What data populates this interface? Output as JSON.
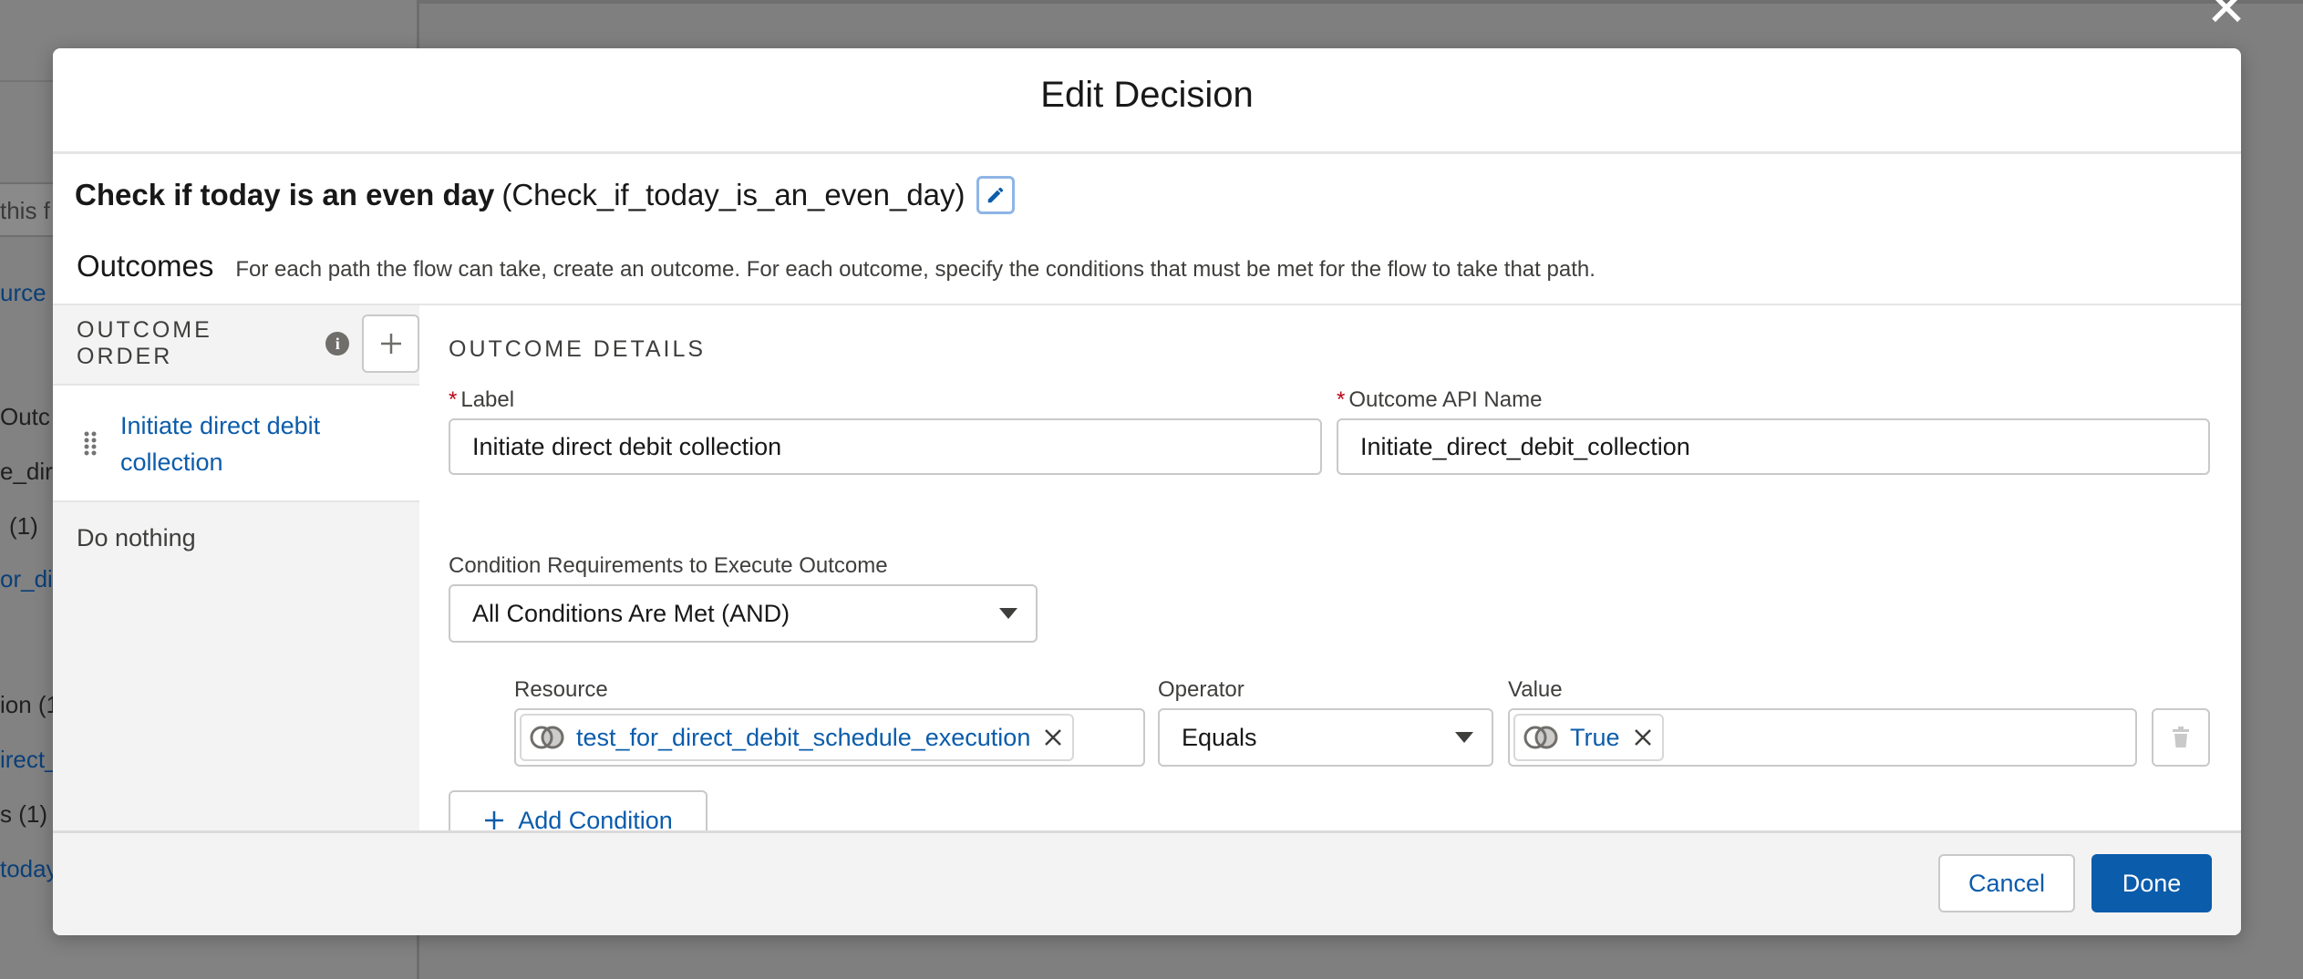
{
  "modal": {
    "title": "Edit Decision",
    "close_icon": "close-icon",
    "element_label": "Check if today is an even day",
    "element_api_name": "(Check_if_today_is_an_even_day)"
  },
  "outcomes": {
    "title": "Outcomes",
    "description": "For each path the flow can take, create an outcome. For each outcome, specify the conditions that must be met for the flow to take that path."
  },
  "outcome_order": {
    "title": "OUTCOME ORDER",
    "items": [
      {
        "label": "Initiate direct debit collection",
        "selected": true
      },
      {
        "label": "Do nothing",
        "selected": false
      }
    ]
  },
  "details": {
    "title": "OUTCOME DETAILS",
    "label_field": {
      "label": "Label",
      "value": "Initiate direct debit collection"
    },
    "api_name_field": {
      "label": "Outcome API Name",
      "value": "Initiate_direct_debit_collection"
    },
    "condition_requirements": {
      "label": "Condition Requirements to Execute Outcome",
      "value": "All Conditions Are Met (AND)"
    },
    "condition": {
      "resource_label": "Resource",
      "resource_value": "test_for_direct_debit_schedule_execution",
      "operator_label": "Operator",
      "operator_value": "Equals",
      "value_label": "Value",
      "value_value": "True"
    },
    "add_condition": "Add Condition"
  },
  "footer": {
    "cancel": "Cancel",
    "done": "Done"
  },
  "background": {
    "fragments": [
      "this f",
      "urce",
      "Outc",
      "e_dire",
      "(1)",
      "or_dir",
      "ion (1",
      "irect_",
      "s (1)",
      "today"
    ]
  },
  "colors": {
    "brand": "#0b5cab",
    "required": "#ba0517",
    "panel": "#f3f3f3"
  }
}
